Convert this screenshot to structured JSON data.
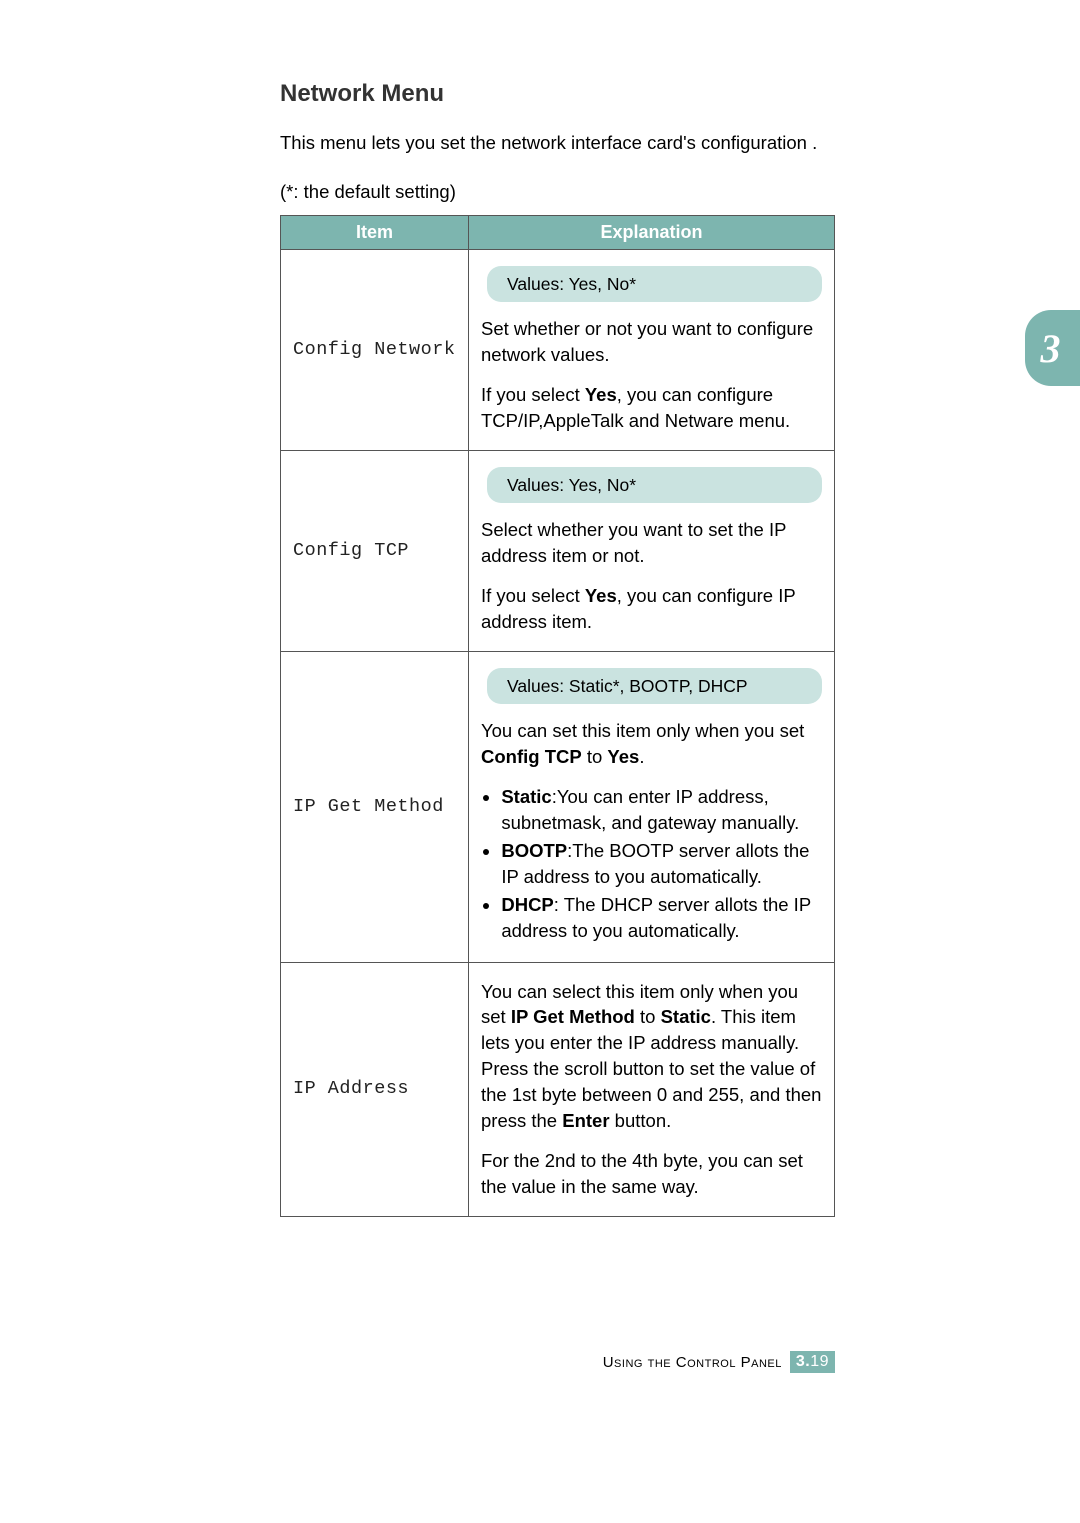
{
  "chapterTab": "3",
  "title": "Network Menu",
  "intro": "This menu lets you set the network interface card's configuration .",
  "note": "(*: the default setting)",
  "headers": {
    "item": "Item",
    "explanation": "Explanation"
  },
  "rows": {
    "configNetwork": {
      "item": "Config Network",
      "values": "Values: Yes, No*",
      "p1": "Set whether or not you want to configure network values.",
      "p2a": "If you select ",
      "p2b": "Yes",
      "p2c": ", you can configure TCP/IP,AppleTalk and Netware menu."
    },
    "configTCP": {
      "item": "Config TCP",
      "values": "Values: Yes, No*",
      "p1": "Select whether you want to set the IP address item or not.",
      "p2a": "If you select ",
      "p2b": "Yes",
      "p2c": ", you can configure IP address item."
    },
    "ipGetMethod": {
      "item": "IP Get Method",
      "values": "Values: Static*, BOOTP, DHCP",
      "p1a": "You can set this item only when you set ",
      "p1b": "Config TCP",
      "p1c": " to ",
      "p1d": "Yes",
      "p1e": ".",
      "b1a": "Static",
      "b1b": ":You can enter IP address, subnetmask, and gateway manually.",
      "b2a": "BOOTP",
      "b2b": ":The BOOTP server allots the IP address to you automatically.",
      "b3a": "DHCP",
      "b3b": ": The DHCP server allots the IP address to you automatically."
    },
    "ipAddress": {
      "item": "IP Address",
      "p1a": "You can select this item only when you set ",
      "p1b": "IP Get Method",
      "p1c": " to ",
      "p1d": "Static",
      "p1e": ". This item lets you enter the IP address manually. Press the scroll button to set the value of the 1st byte between 0 and 255, and then press the ",
      "p1f": "Enter",
      "p1g": " button.",
      "p2": "For the 2nd to the 4th byte, you can set the value in the same way."
    }
  },
  "footer": {
    "text": "Using the Control Panel",
    "chapter": "3.",
    "page": "19"
  }
}
